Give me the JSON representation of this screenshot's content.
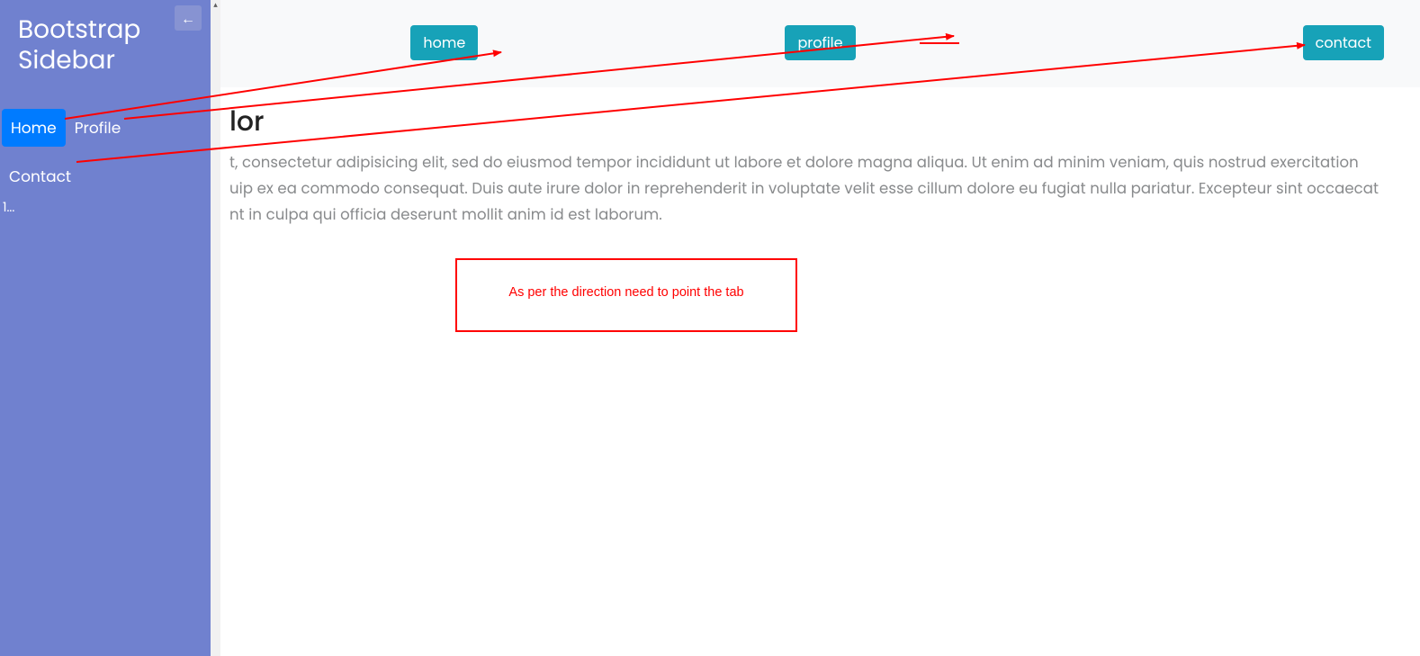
{
  "sidebar": {
    "title": "Bootstrap Sidebar",
    "toggle_icon": "←",
    "nav": {
      "home": "Home",
      "profile": "Profile",
      "contact": "Contact"
    },
    "footer_marker": "1..."
  },
  "topbar": {
    "home_label": "home",
    "profile_label": "profile",
    "contact_label": "contact"
  },
  "content": {
    "title_visible_fragment": "lor",
    "body_line1_fragment": "t, consectetur adipisicing elit, sed do eiusmod tempor incididunt ut labore et dolore magna aliqua. Ut enim ad minim veniam, quis nostrud exercitation",
    "body_line2_fragment": "uip ex ea commodo consequat. Duis aute irure dolor in reprehenderit in voluptate velit esse cillum dolore eu fugiat nulla pariatur. Excepteur sint occaecat",
    "body_line3_fragment": "nt in culpa qui officia deserunt mollit anim id est laborum."
  },
  "annotation": {
    "text": "As per the direction need to point the tab"
  },
  "colors": {
    "sidebar_bg": "#7081cf",
    "active_nav": "#007bff",
    "btn_teal": "#17a2b8",
    "arrow_red": "#ff0000"
  }
}
